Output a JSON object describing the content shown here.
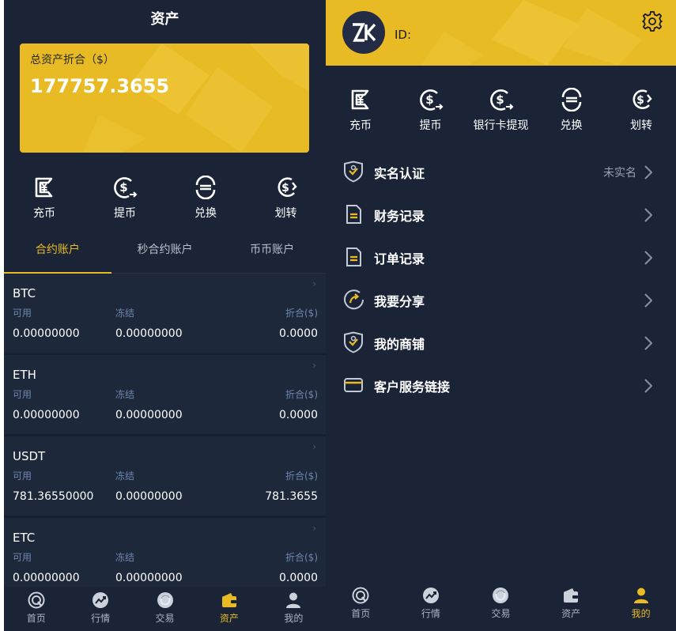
{
  "assets": {
    "title": "资产",
    "balance_label": "总资产折合（$）",
    "balance_value": "177757.3655",
    "actions": [
      {
        "label": "充币",
        "icon": "deposit-icon"
      },
      {
        "label": "提币",
        "icon": "withdraw-icon"
      },
      {
        "label": "兑换",
        "icon": "exchange-icon"
      },
      {
        "label": "划转",
        "icon": "transfer-icon"
      }
    ],
    "tabs": [
      "合约账户",
      "秒合约账户",
      "币币账户"
    ],
    "active_tab": 0,
    "column_labels": {
      "available": "可用",
      "frozen": "冻结",
      "converted": "折合($)"
    },
    "coins": [
      {
        "name": "BTC",
        "available": "0.00000000",
        "frozen": "0.00000000",
        "converted": "0.0000"
      },
      {
        "name": "ETH",
        "available": "0.00000000",
        "frozen": "0.00000000",
        "converted": "0.0000"
      },
      {
        "name": "USDT",
        "available": "781.36550000",
        "frozen": "0.00000000",
        "converted": "781.3655"
      },
      {
        "name": "ETC",
        "available": "0.00000000",
        "frozen": "0.00000000",
        "converted": "0.0000"
      }
    ]
  },
  "nav": {
    "items": [
      {
        "label": "首页",
        "icon": "home-icon"
      },
      {
        "label": "行情",
        "icon": "market-icon"
      },
      {
        "label": "交易",
        "icon": "trade-icon"
      },
      {
        "label": "资产",
        "icon": "wallet-icon"
      },
      {
        "label": "我的",
        "icon": "user-icon"
      }
    ],
    "left_active": 3,
    "right_active": 4
  },
  "profile": {
    "id_label": "ID:",
    "actions": [
      {
        "label": "充币",
        "icon": "deposit-icon"
      },
      {
        "label": "提币",
        "icon": "withdraw-icon"
      },
      {
        "label": "银行卡提现",
        "icon": "bank-withdraw-icon"
      },
      {
        "label": "兑换",
        "icon": "exchange-icon"
      },
      {
        "label": "划转",
        "icon": "transfer-icon"
      }
    ],
    "menu": [
      {
        "label": "实名认证",
        "status": "未实名",
        "icon": "shield-check-icon"
      },
      {
        "label": "财务记录",
        "status": "",
        "icon": "document-icon"
      },
      {
        "label": "订单记录",
        "status": "",
        "icon": "document-icon"
      },
      {
        "label": "我要分享",
        "status": "",
        "icon": "share-icon"
      },
      {
        "label": "我的商铺",
        "status": "",
        "icon": "shop-icon"
      },
      {
        "label": "客户服务链接",
        "status": "",
        "icon": "card-icon"
      }
    ]
  },
  "colors": {
    "accent": "#e8bb25",
    "background": "#1b2436",
    "card": "#1e283b",
    "muted_label": "#6d86ad"
  }
}
